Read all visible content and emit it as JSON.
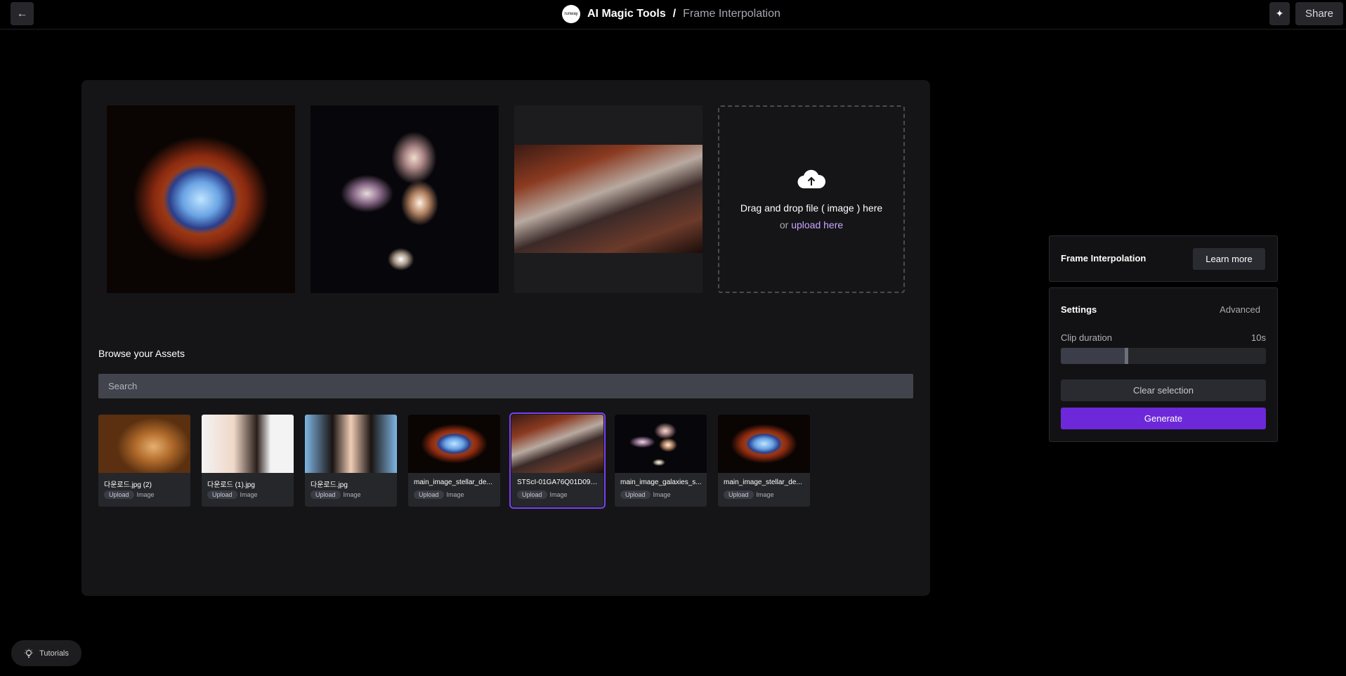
{
  "header": {
    "logo_text": "runway",
    "app_name": "AI Magic Tools",
    "separator": "/",
    "page_name": "Frame Interpolation",
    "share_label": "Share"
  },
  "upload": {
    "drop_text": "Drag and drop file ( image ) here",
    "or_text": "or ",
    "link_text": "upload here"
  },
  "assets": {
    "title": "Browse your Assets",
    "search_placeholder": "Search",
    "items": [
      {
        "name": "다운로드.jpg (2)",
        "tag": "Upload",
        "kind": "Image"
      },
      {
        "name": "다운로드 (1).jpg",
        "tag": "Upload",
        "kind": "Image"
      },
      {
        "name": "다운로드.jpg",
        "tag": "Upload",
        "kind": "Image"
      },
      {
        "name": "main_image_stellar_de...",
        "tag": "Upload",
        "kind": "Image"
      },
      {
        "name": "STScI-01GA76Q01D09H...",
        "tag": "Upload",
        "kind": "Image"
      },
      {
        "name": "main_image_galaxies_s...",
        "tag": "Upload",
        "kind": "Image"
      },
      {
        "name": "main_image_stellar_de...",
        "tag": "Upload",
        "kind": "Image"
      }
    ]
  },
  "info": {
    "title": "Frame Interpolation",
    "learn_more": "Learn more"
  },
  "settings": {
    "title": "Settings",
    "advanced": "Advanced",
    "clip_label": "Clip duration",
    "clip_value": "10s",
    "clip_fraction": 0.31,
    "clear_label": "Clear selection",
    "generate_label": "Generate"
  },
  "tutorials_label": "Tutorials",
  "colors": {
    "accent": "#6d28d9",
    "link": "#c9a6ff",
    "selected_outline": "#7b3ff2"
  }
}
